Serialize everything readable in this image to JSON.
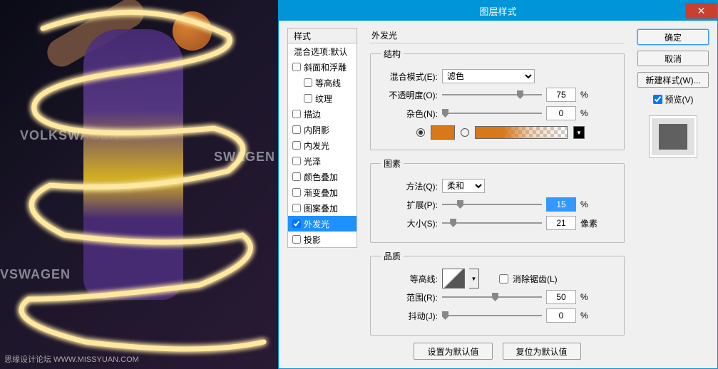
{
  "arena_text": "VOLKSWAGEN",
  "arena_text2": "SWAGEN",
  "arena_text3": "VSWAGEN",
  "watermark": "思缘设计论坛 WWW.MISSYUAN.COM",
  "dialog": {
    "title": "图层样式"
  },
  "styles": {
    "header": "样式",
    "items": [
      {
        "label": "混合选项:默认",
        "checkbox": false
      },
      {
        "label": "斜面和浮雕",
        "checkbox": true,
        "checked": false
      },
      {
        "label": "等高线",
        "checkbox": true,
        "checked": false,
        "indent": true
      },
      {
        "label": "纹理",
        "checkbox": true,
        "checked": false,
        "indent": true
      },
      {
        "label": "描边",
        "checkbox": true,
        "checked": false
      },
      {
        "label": "内阴影",
        "checkbox": true,
        "checked": false
      },
      {
        "label": "内发光",
        "checkbox": true,
        "checked": false
      },
      {
        "label": "光泽",
        "checkbox": true,
        "checked": false
      },
      {
        "label": "颜色叠加",
        "checkbox": true,
        "checked": false
      },
      {
        "label": "渐变叠加",
        "checkbox": true,
        "checked": false
      },
      {
        "label": "图案叠加",
        "checkbox": true,
        "checked": false
      },
      {
        "label": "外发光",
        "checkbox": true,
        "checked": true,
        "selected": true
      },
      {
        "label": "投影",
        "checkbox": true,
        "checked": false
      }
    ]
  },
  "main": {
    "title": "外发光",
    "group_struct": "结构",
    "blend_label": "混合模式(E):",
    "blend_value": "滤色",
    "opacity_label": "不透明度(O):",
    "opacity_value": "75",
    "noise_label": "杂色(N):",
    "noise_value": "0",
    "pct": "%",
    "swatch_color": "#d87818",
    "group_elem": "图素",
    "technique_label": "方法(Q):",
    "technique_value": "柔和",
    "spread_label": "扩展(P):",
    "spread_value": "15",
    "size_label": "大小(S):",
    "size_value": "21",
    "px": "像素",
    "group_quality": "品质",
    "contour_label": "等高线:",
    "antialias_label": "消除锯齿(L)",
    "range_label": "范围(R):",
    "range_value": "50",
    "jitter_label": "抖动(J):",
    "jitter_value": "0",
    "btn_default": "设置为默认值",
    "btn_reset": "复位为默认值"
  },
  "right": {
    "ok": "确定",
    "cancel": "取消",
    "newstyle": "新建样式(W)...",
    "preview": "预览(V)"
  }
}
